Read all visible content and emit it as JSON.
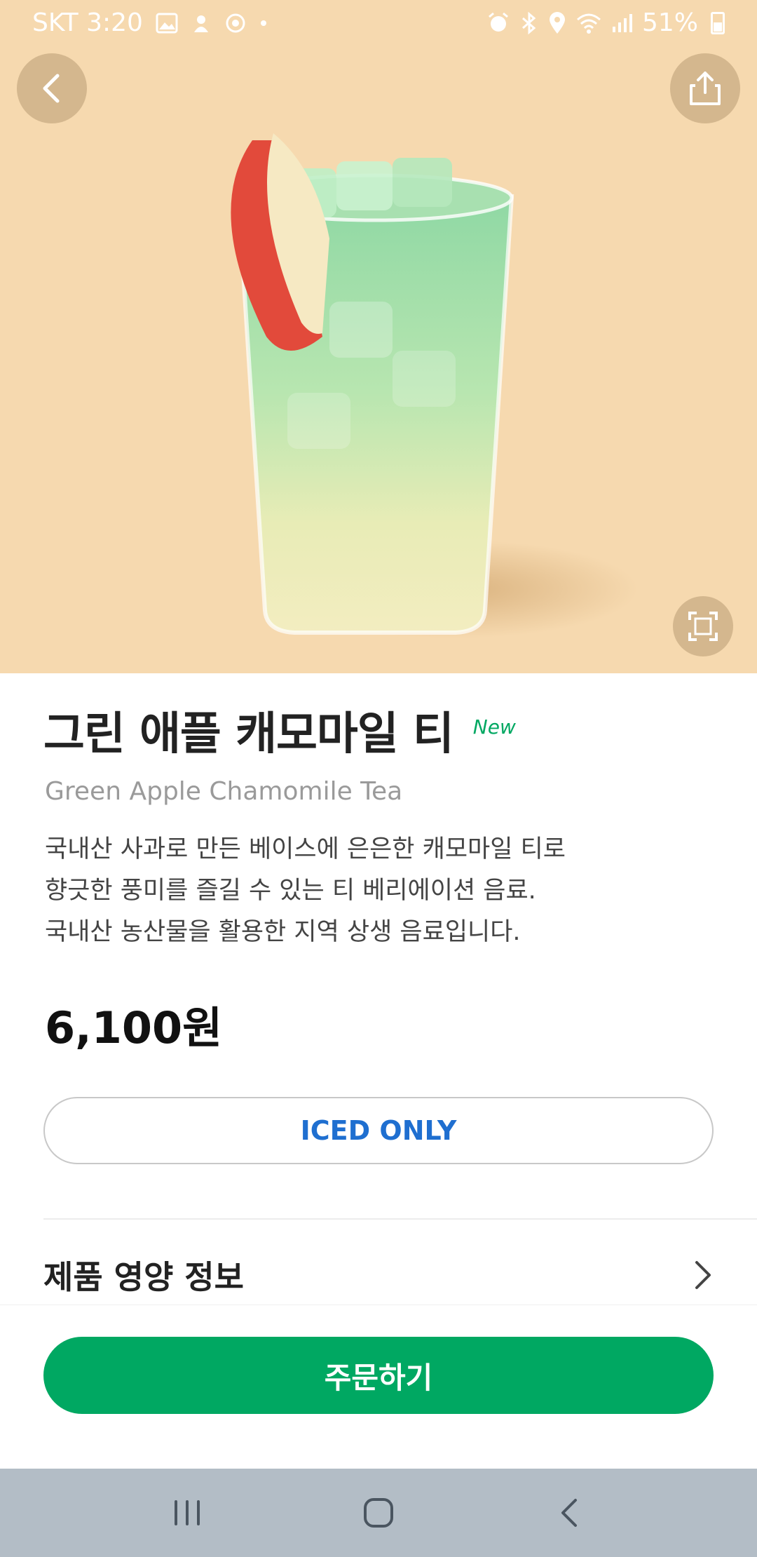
{
  "status_bar": {
    "carrier_time": "SKT 3:20",
    "battery": "51%"
  },
  "product": {
    "name_ko": "그린 애플 캐모마일 티",
    "badge": "New",
    "name_en": "Green Apple Chamomile Tea",
    "description": [
      "국내산 사과로 만든 베이스에 은은한 캐모마일 티로",
      "향긋한 풍미를 즐길 수 있는 티 베리에이션 음료.",
      "국내산 농산물을 활용한 지역 상생 음료입니다."
    ],
    "price": "6,100원",
    "temperature_option": "ICED ONLY",
    "nutrition_label": "제품 영양 정보"
  },
  "order": {
    "button_label": "주문하기"
  },
  "colors": {
    "hero_bg": "#f6d9af",
    "accent_green": "#00a862",
    "iced_blue": "#1f6fd0",
    "nav_bg": "#b3bdc6"
  },
  "icons": [
    "back-arrow-icon",
    "share-icon",
    "expand-icon",
    "chevron-right-icon",
    "recent-apps-icon",
    "home-icon",
    "nav-back-icon"
  ]
}
